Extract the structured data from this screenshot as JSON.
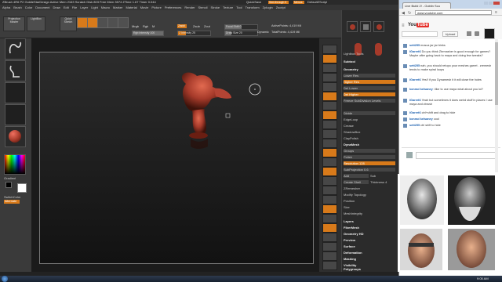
{
  "zbrush": {
    "title": "ZBrush 4R6 P2   GoldieStarDesign   Active Mem 2163  Scratch Disk 803  Free Mem 3574  ZTime 1.67  Timer 0.044",
    "quicksave": "QuickSave",
    "see_through": "See-through 0",
    "menus_btn": "Menus",
    "default_script": "DefaultZScript",
    "menus": [
      "Alpha",
      "Brush",
      "Color",
      "Document",
      "Draw",
      "Edit",
      "File",
      "Layer",
      "Light",
      "Macro",
      "Marker",
      "Material",
      "Movie",
      "Picture",
      "Preferences",
      "Render",
      "Stencil",
      "Stroke",
      "Texture",
      "Tool",
      "Transform",
      "Zplugin",
      "Zscript"
    ],
    "shelf": {
      "projection_master": "Projection Master",
      "lightbox": "LightBox",
      "quick_sketch": "Quick Sketch",
      "edit": "Edit",
      "draw": "Draw",
      "move": "Move",
      "scale": "Scale",
      "rotate": "Rotate",
      "mrgb": "Mrgb",
      "rgb": "Rgb",
      "m": "M",
      "zadd": "Zadd",
      "zsub": "Zsub",
      "zcut": "Zcut",
      "rgb_intensity": "Rgb Intensity 100",
      "z_intensity": "Z Intensity 25",
      "focal_shift": "Focal Shift 0",
      "draw_size": "Draw Size 20",
      "dynamic": "Dynamic",
      "active_points": "ActivePoints: 4,419 Mil",
      "total_points": "TotalPoints: 4,419 Mil"
    },
    "left": {
      "gradient": "Gradient",
      "switch_color": "SwitchColor",
      "alternate": "Alternate"
    },
    "tray": {
      "lightbox_tools": "Lightbox Tools",
      "subtool": "Subtool",
      "geometry": "Geometry",
      "lower_res": "Lower Res",
      "higher_res": "Higher Res",
      "del_lower": "Del Lower",
      "del_higher": "Del Higher",
      "freeze_subdiv": "Freeze SubDivision Levels",
      "divide": "Divide",
      "edge_loop": "EdgeLoop",
      "crease": "Crease",
      "shadowbox": "ShadowBox",
      "clay_polish": "ClayPolish",
      "dynamesh": "DynaMesh",
      "groups": "Groups",
      "polish": "Polish",
      "resolution": "Resolution 128",
      "sub_projection": "SubProjection 0.6",
      "add": "Add",
      "sub": "Sub",
      "create_shell": "Create Shell",
      "thickness": "Thickness 4",
      "zremesher": "ZRemesher",
      "modify_topology": "Modify Topology",
      "position": "Position",
      "size": "Size",
      "meshintegrity": "MeshIntegrity",
      "layers": "Layers",
      "fibermesh": "FiberMesh",
      "geometry_hd": "Geometry HD",
      "preview": "Preview",
      "surface": "Surface",
      "deformation": "Deformation",
      "masking": "Masking",
      "visibility": "Visibility",
      "polygroups": "Polygroups"
    }
  },
  "taskbar": {
    "time": "9:05 AM"
  },
  "chrome": {
    "tab_title": "Live Build 2! - Goblin Scu",
    "url": "www.youtube.com",
    "upload_btn": "Upload",
    "youtube_logo": "YouTube",
    "chat": [
      {
        "name": "sett255",
        "text": "mosca jar jar binks"
      },
      {
        "name": "IGarret6",
        "text": "Do you think Zbrmasher is good enough for games? Maybe after going back to maya and doing few tweaks?"
      },
      {
        "name": "sett255",
        "text": "nah, you should retopo your meshes garret . zremesh tends to make spiral loops"
      },
      {
        "name": "IGarret6",
        "text": "Yes!! if you Dynamesh it it will close the holes"
      },
      {
        "name": "konrad kelsaney",
        "text": "i like to use maya what about you  lol?"
      },
      {
        "name": "IGarret6",
        "text": "Yeah but sometimes it does weird stuff in places  I use maya and zbrush"
      },
      {
        "name": "IGarret6",
        "text": "ctrl+shift and drag to hide"
      },
      {
        "name": "konrad kelsaney",
        "text": "cool"
      },
      {
        "name": "sett255",
        "text": "ctrl shift to hide"
      }
    ]
  },
  "colors": {
    "zbrush_orange": "#d87a1a",
    "model_red": "#a63a2a",
    "youtube_red": "#e52d27"
  }
}
